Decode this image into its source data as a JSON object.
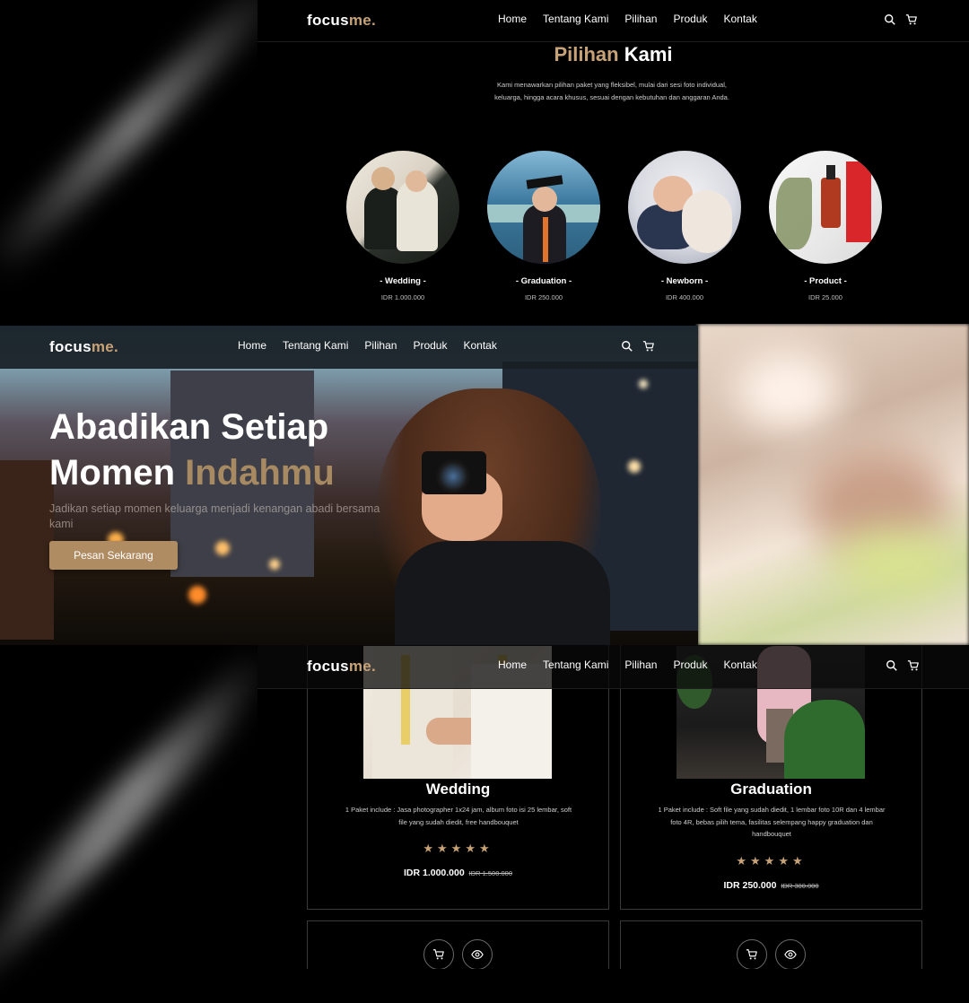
{
  "brand": {
    "name_main": "focus",
    "name_accent": "me.",
    "accent_color": "#c7a276"
  },
  "nav": {
    "links": [
      "Home",
      "Tentang Kami",
      "Pilihan",
      "Produk",
      "Kontak"
    ],
    "icons": [
      "search-icon",
      "cart-icon"
    ]
  },
  "choices": {
    "title_accent": "Pilihan",
    "title_rest": "Kami",
    "description": "Kami menawarkan pilihan paket yang fleksibel, mulai dari sesi foto individual, keluarga, hingga acara khusus, sesuai dengan kebutuhan dan anggaran Anda.",
    "categories": [
      {
        "name": "- Wedding -",
        "price": "IDR 1.000.000"
      },
      {
        "name": "- Graduation -",
        "price": "IDR 250.000"
      },
      {
        "name": "- Newborn -",
        "price": "IDR 400.000"
      },
      {
        "name": "- Product -",
        "price": "IDR 25.000"
      }
    ]
  },
  "hero": {
    "title_line1": "Abadikan Setiap",
    "title_line2_white": "Momen",
    "title_line2_accent": "Indahmu",
    "subtitle": "Jadikan setiap momen keluarga menjadi kenangan abadi bersama kami",
    "cta_label": "Pesan Sekarang"
  },
  "products": [
    {
      "title": "Wedding",
      "description": "1 Paket include : Jasa photographer 1x24 jam, album foto isi 25 lembar, soft file yang sudah diedit, free handbouquet",
      "rating": 5,
      "stars": "★★★★★",
      "price": "IDR 1.000.000",
      "old_price": "IDR 1.500.000"
    },
    {
      "title": "Graduation",
      "description": "1 Paket include : Soft file yang sudah diedit, 1 lembar foto 10R dan 4 lembar foto 4R, bebas pilih tema, fasilitas selempang happy graduation dan handbouquet",
      "rating": 5,
      "stars": "★★★★★",
      "price": "IDR 250.000",
      "old_price": "IDR 300.000"
    }
  ]
}
